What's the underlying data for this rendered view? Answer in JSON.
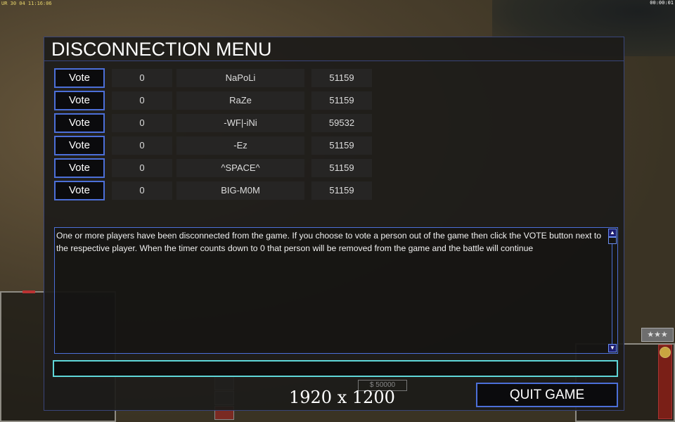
{
  "hud": {
    "top_left": "UR 30 04 11:16:06",
    "clock": "00:00:01",
    "stars": "★★★",
    "money": "$ 50000"
  },
  "menu": {
    "title": "DISCONNECTION MENU",
    "players": [
      {
        "vote_label": "Vote",
        "timer": "0",
        "name": "NaPoLi",
        "id": "51159"
      },
      {
        "vote_label": "Vote",
        "timer": "0",
        "name": "RaZe",
        "id": "51159"
      },
      {
        "vote_label": "Vote",
        "timer": "0",
        "name": "-WF|-iNi",
        "id": "59532"
      },
      {
        "vote_label": "Vote",
        "timer": "0",
        "name": "-Ez",
        "id": "51159"
      },
      {
        "vote_label": "Vote",
        "timer": "0",
        "name": "^SPACE^",
        "id": "51159"
      },
      {
        "vote_label": "Vote",
        "timer": "0",
        "name": "BIG-M0M",
        "id": "51159"
      }
    ],
    "message": "One or more players have been disconnected from the game. If you choose to vote a person out of the game then click the VOTE button next to the respective player. When the timer counts down to 0 that person will be removed from the game and the battle will continue",
    "chat_value": "",
    "resolution_label": "1920 x 1200",
    "quit_label": "QUIT GAME"
  },
  "colors": {
    "accent": "#4c6fd8",
    "input_border": "#5fd6d8",
    "panel_bg": "#1c1b19"
  }
}
